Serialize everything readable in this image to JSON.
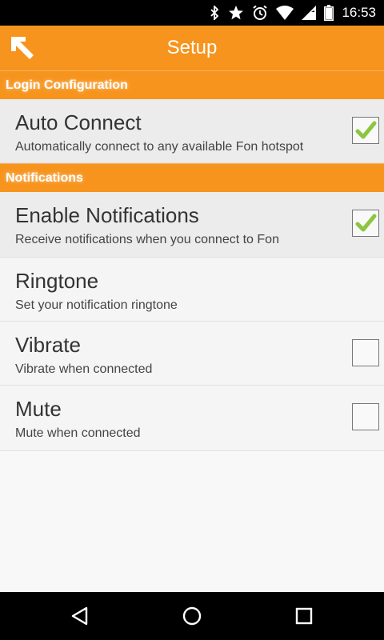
{
  "status_bar": {
    "time": "16:53",
    "icons": [
      "bluetooth-icon",
      "star-icon",
      "alarm-icon",
      "wifi-icon",
      "signal-icon",
      "battery-icon"
    ]
  },
  "action_bar": {
    "title": "Setup",
    "back_icon": "up-arrow-icon"
  },
  "sections": [
    {
      "header": "Login Configuration",
      "items": [
        {
          "title": "Auto Connect",
          "summary": "Automatically connect to any available Fon hotspot",
          "checked": true
        }
      ]
    },
    {
      "header": "Notifications",
      "items": [
        {
          "title": "Enable Notifications",
          "summary": "Receive notifications when you connect to Fon",
          "checked": true
        },
        {
          "title": "Ringtone",
          "summary": "Set your notification ringtone"
        },
        {
          "title": "Vibrate",
          "summary": "Vibrate when connected",
          "checked": false
        },
        {
          "title": "Mute",
          "summary": "Mute when connected",
          "checked": false
        }
      ]
    }
  ],
  "colors": {
    "accent": "#f7941d",
    "check": "#8cc63f"
  },
  "nav_bar": {
    "icons": [
      "back-icon",
      "home-icon",
      "recents-icon"
    ]
  }
}
